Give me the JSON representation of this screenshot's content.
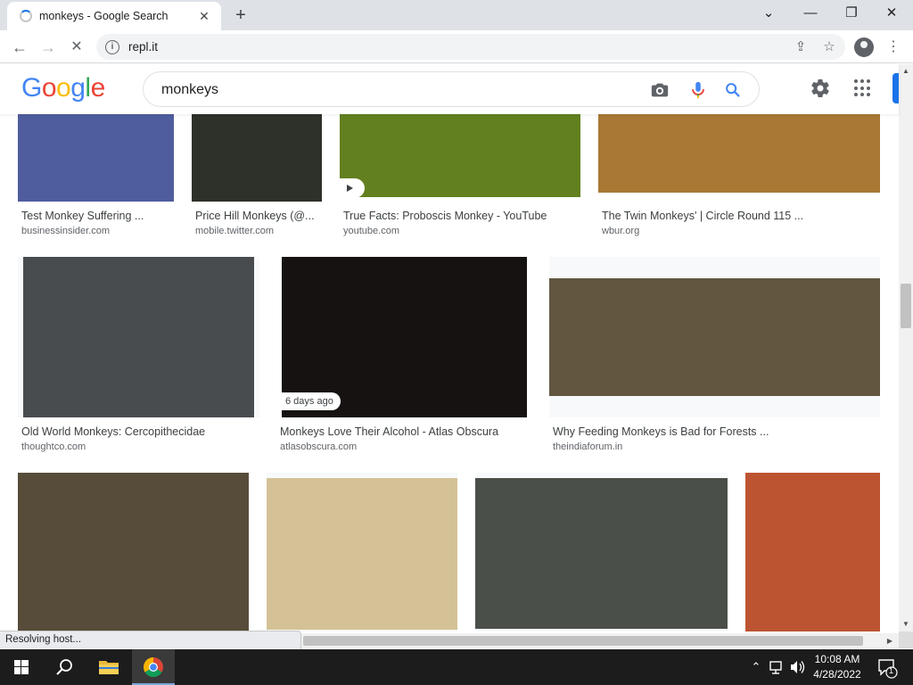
{
  "browser": {
    "tab_title": "monkeys - Google Search",
    "url": "repl.it",
    "status_text": "Resolving host..."
  },
  "google": {
    "logo_letters": [
      "G",
      "o",
      "o",
      "g",
      "l",
      "e"
    ],
    "logo_colors": [
      "#4285F4",
      "#EA4335",
      "#FBBC05",
      "#4285F4",
      "#34A853",
      "#EA4335"
    ],
    "query": "monkeys",
    "accent": "#1a73e8"
  },
  "results": [
    {
      "title": "Test Monkey Suffering ...",
      "source": "businessinsider.com",
      "color": "#4f5d9e"
    },
    {
      "title": "Price Hill Monkeys (@...",
      "source": "mobile.twitter.com",
      "color": "#2e312a"
    },
    {
      "title": "True Facts: Proboscis Monkey - YouTube",
      "source": "youtube.com",
      "color": "#62801f"
    },
    {
      "title": "The Twin Monkeys' | Circle Round 115 ...",
      "source": "wbur.org",
      "color": "#a87834"
    },
    {
      "title": "Old World Monkeys: Cercopithecidae",
      "source": "thoughtco.com",
      "color": "#494c4f"
    },
    {
      "title": "Monkeys Love Their Alcohol - Atlas Obscura",
      "source": "atlasobscura.com",
      "color": "#161211",
      "badge": "6 days ago"
    },
    {
      "title": "Why Feeding Monkeys is Bad for Forests ...",
      "source": "theindiaforum.in",
      "color": "#625641"
    },
    {
      "title": "",
      "source": "",
      "color": "#574c3a"
    },
    {
      "title": "",
      "source": "",
      "color": "#d4c296"
    },
    {
      "title": "",
      "source": "",
      "color": "#4a4f4a"
    },
    {
      "title": "",
      "source": "",
      "color": "#bd5431"
    }
  ],
  "taskbar": {
    "time": "10:08 AM",
    "date": "4/28/2022",
    "notification_count": "1"
  },
  "icons": {
    "tab_close": "close-icon",
    "new_tab": "plus-icon",
    "back": "arrow-left-icon",
    "forward": "arrow-right-icon",
    "reload": "stop-icon",
    "site_info": "info-icon",
    "share": "share-icon",
    "bookmark": "star-icon",
    "camera": "camera-icon",
    "mic": "microphone-icon",
    "search": "search-icon",
    "settings": "gear-icon",
    "apps": "apps-grid-icon"
  }
}
